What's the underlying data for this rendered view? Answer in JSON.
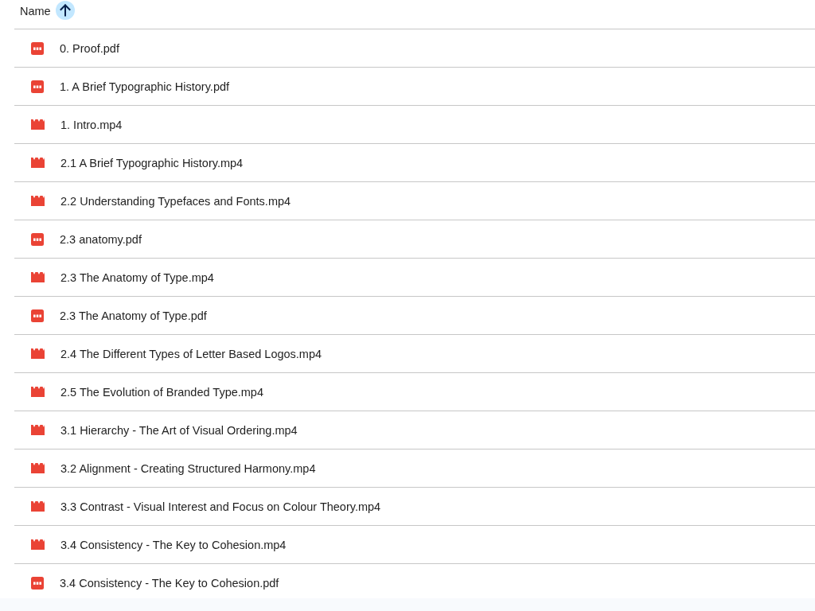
{
  "header": {
    "column_label": "Name",
    "sort_ascending": true
  },
  "files": [
    {
      "name": "0. Proof.pdf",
      "kind": "pdf"
    },
    {
      "name": "1. A Brief Typographic History.pdf",
      "kind": "pdf"
    },
    {
      "name": "1. Intro.mp4",
      "kind": "video"
    },
    {
      "name": "2.1 A Brief Typographic History.mp4",
      "kind": "video"
    },
    {
      "name": "2.2 Understanding Typefaces and Fonts.mp4",
      "kind": "video"
    },
    {
      "name": "2.3 anatomy.pdf",
      "kind": "pdf"
    },
    {
      "name": "2.3 The Anatomy of Type.mp4",
      "kind": "video"
    },
    {
      "name": "2.3 The Anatomy of Type.pdf",
      "kind": "pdf"
    },
    {
      "name": "2.4 The Different Types of Letter Based Logos.mp4",
      "kind": "video"
    },
    {
      "name": "2.5 The Evolution of Branded Type.mp4",
      "kind": "video"
    },
    {
      "name": "3.1 Hierarchy - The Art of Visual Ordering.mp4",
      "kind": "video"
    },
    {
      "name": "3.2 Alignment - Creating Structured Harmony.mp4",
      "kind": "video"
    },
    {
      "name": "3.3 Contrast - Visual Interest and Focus on Colour Theory.mp4",
      "kind": "video"
    },
    {
      "name": "3.4 Consistency - The Key to Cohesion.mp4",
      "kind": "video"
    },
    {
      "name": "3.4 Consistency - The Key to Cohesion.pdf",
      "kind": "pdf"
    }
  ]
}
